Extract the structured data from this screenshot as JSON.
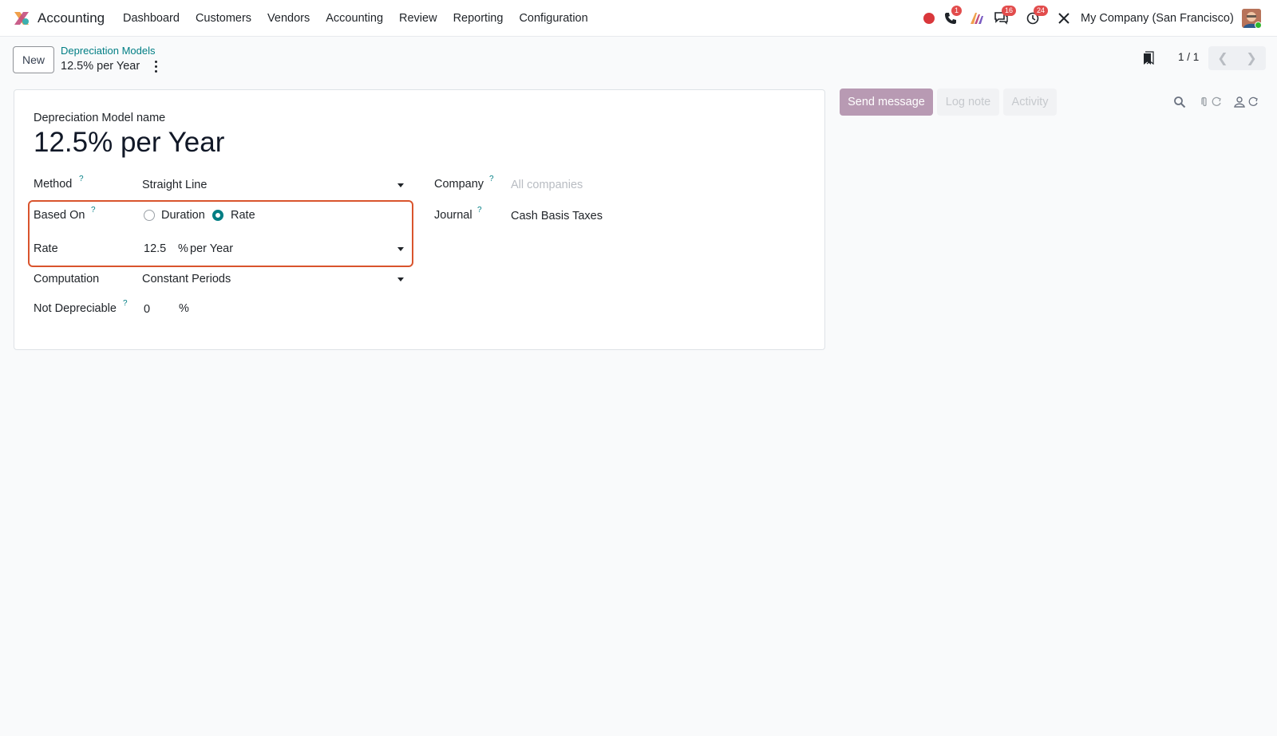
{
  "app": {
    "name": "Accounting",
    "menu": [
      "Dashboard",
      "Customers",
      "Vendors",
      "Accounting",
      "Review",
      "Reporting",
      "Configuration"
    ],
    "company": "My Company (San Francisco)",
    "badges": {
      "phone": "1",
      "messages": "16",
      "activities": "24"
    },
    "colors": {
      "accent": "#017e84",
      "highlight": "#d9542d",
      "send_button": "#b89ab3"
    }
  },
  "control": {
    "new_label": "New",
    "breadcrumb_parent": "Depreciation Models",
    "breadcrumb_current": "12.5% per Year",
    "pager": "1 / 1"
  },
  "form": {
    "title_label": "Depreciation Model name",
    "title_value": "12.5% per Year",
    "method_label": "Method",
    "method_value": "Straight Line",
    "based_on_label": "Based On",
    "based_on_options": [
      "Duration",
      "Rate"
    ],
    "based_on_selected": "Rate",
    "rate_label": "Rate",
    "rate_value": "12.5",
    "rate_unit": "%",
    "rate_period": "per Year",
    "computation_label": "Computation",
    "computation_value": "Constant Periods",
    "not_depreciable_label": "Not Depreciable",
    "not_depreciable_value": "0",
    "not_depreciable_unit": "%",
    "company_label": "Company",
    "company_placeholder": "All companies",
    "journal_label": "Journal",
    "journal_value": "Cash Basis Taxes",
    "help_mark": "?"
  },
  "chatter": {
    "send_message": "Send message",
    "log_note": "Log note",
    "activity": "Activity"
  }
}
